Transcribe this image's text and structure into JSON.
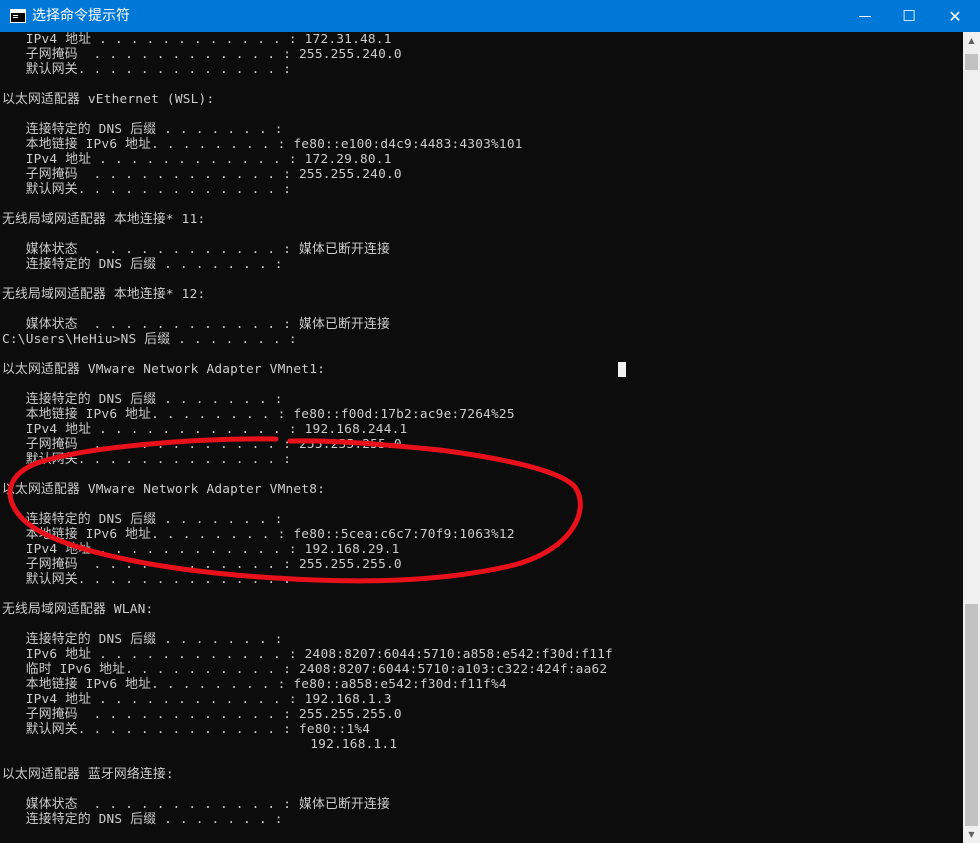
{
  "window": {
    "title": "选择命令提示符",
    "minimize_glyph": "—",
    "maximize_glyph": "☐",
    "close_glyph": "✕",
    "icon": "terminal-icon"
  },
  "console": {
    "text_color": "#cccccc",
    "background": "#0c0c0c",
    "lines": [
      "   IPv4 地址 . . . . . . . . . . . . : 172.31.48.1",
      "   子网掩码  . . . . . . . . . . . . : 255.255.240.0",
      "   默认网关. . . . . . . . . . . . . :",
      "",
      "以太网适配器 vEthernet (WSL):",
      "",
      "   连接特定的 DNS 后缀 . . . . . . . :",
      "   本地链接 IPv6 地址. . . . . . . . : fe80::e100:d4c9:4483:4303%101",
      "   IPv4 地址 . . . . . . . . . . . . : 172.29.80.1",
      "   子网掩码  . . . . . . . . . . . . : 255.255.240.0",
      "   默认网关. . . . . . . . . . . . . :",
      "",
      "无线局域网适配器 本地连接* 11:",
      "",
      "   媒体状态  . . . . . . . . . . . . : 媒体已断开连接",
      "   连接特定的 DNS 后缀 . . . . . . . :",
      "",
      "无线局域网适配器 本地连接* 12:",
      "",
      "   媒体状态  . . . . . . . . . . . . : 媒体已断开连接",
      "C:\\Users\\HeHiu>NS 后缀 . . . . . . . :",
      "",
      "以太网适配器 VMware Network Adapter VMnet1:",
      "",
      "   连接特定的 DNS 后缀 . . . . . . . :",
      "   本地链接 IPv6 地址. . . . . . . . : fe80::f00d:17b2:ac9e:7264%25",
      "   IPv4 地址 . . . . . . . . . . . . : 192.168.244.1",
      "   子网掩码  . . . . . . . . . . . . : 255.255.255.0",
      "   默认网关. . . . . . . . . . . . . :",
      "",
      "以太网适配器 VMware Network Adapter VMnet8:",
      "",
      "   连接特定的 DNS 后缀 . . . . . . . :",
      "   本地链接 IPv6 地址. . . . . . . . : fe80::5cea:c6c7:70f9:1063%12",
      "   IPv4 地址 . . . . . . . . . . . . : 192.168.29.1",
      "   子网掩码  . . . . . . . . . . . . : 255.255.255.0",
      "   默认网关. . . . . . . . . . . . . :",
      "",
      "无线局域网适配器 WLAN:",
      "",
      "   连接特定的 DNS 后缀 . . . . . . . :",
      "   IPv6 地址 . . . . . . . . . . . . : 2408:8207:6044:5710:a858:e542:f30d:f11f",
      "   临时 IPv6 地址. . . . . . . . . . : 2408:8207:6044:5710:a103:c322:424f:aa62",
      "   本地链接 IPv6 地址. . . . . . . . : fe80::a858:e542:f30d:f11f%4",
      "   IPv4 地址 . . . . . . . . . . . . : 192.168.1.3",
      "   子网掩码  . . . . . . . . . . . . : 255.255.255.0",
      "   默认网关. . . . . . . . . . . . . : fe80::1%4",
      "                                       192.168.1.1",
      "",
      "以太网适配器 蓝牙网络连接:",
      "",
      "   媒体状态  . . . . . . . . . . . . : 媒体已断开连接",
      "   连接特定的 DNS 后缀 . . . . . . . :"
    ]
  },
  "annotation": {
    "shape": "freehand ellipse",
    "color": "#e8101a",
    "highlights": "以太网适配器 VMware Network Adapter VMnet8"
  },
  "scrollbar": {
    "up_glyph": "▲",
    "down_glyph": "▼"
  }
}
